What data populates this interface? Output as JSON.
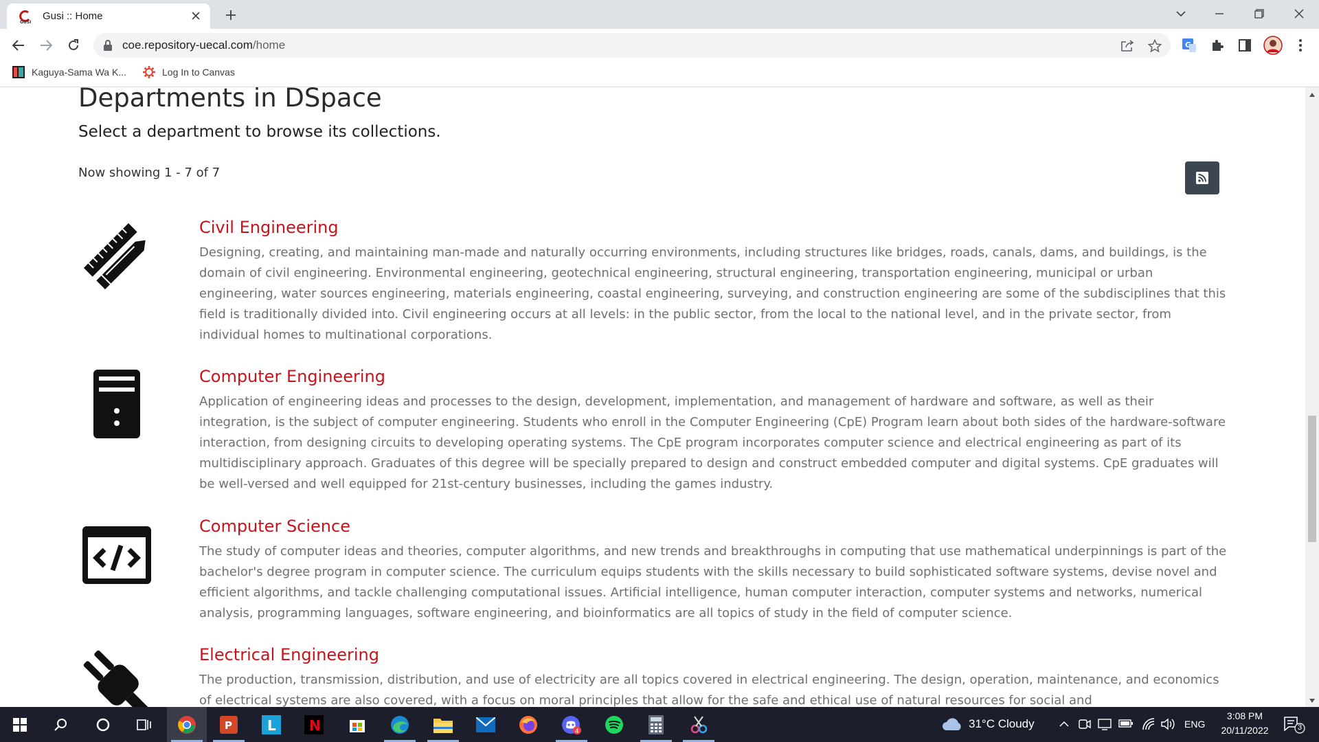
{
  "browser": {
    "tab_title": "Gusi :: Home",
    "url_domain": "coe.repository-uecal.com",
    "url_path": "/home",
    "bookmarks": [
      {
        "label": "Kaguya-Sama Wa K...",
        "icon": "manga-icon"
      },
      {
        "label": "Log In to Canvas",
        "icon": "canvas-icon"
      }
    ]
  },
  "page": {
    "heading": "Departments in DSpace",
    "subheading": "Select a department to browse its collections.",
    "showing": "Now showing 1 - 7 of 7",
    "departments": [
      {
        "title": "Civil Engineering",
        "icon": "ruler-pencil-icon",
        "description": "Designing, creating, and maintaining man-made and naturally occurring environments, including structures like bridges, roads, canals, dams, and buildings, is the domain of civil engineering. Environmental engineering, geotechnical engineering, structural engineering, transportation engineering, municipal or urban engineering, water sources engineering, materials engineering, coastal engineering, surveying, and construction engineering are some of the subdisciplines that this field is traditionally divided into. Civil engineering occurs at all levels: in the public sector, from the local to the national level, and in the private sector, from individual homes to multinational corporations."
      },
      {
        "title": "Computer Engineering",
        "icon": "computer-tower-icon",
        "description": "Application of engineering ideas and processes to the design, development, implementation, and management of hardware and software, as well as their integration, is the subject of computer engineering. Students who enroll in the Computer Engineering (CpE) Program learn about both sides of the hardware-software interaction, from designing circuits to developing operating systems. The CpE program incorporates computer science and electrical engineering as part of its multidisciplinary approach. Graduates of this degree will be specially prepared to design and construct embedded computer and digital systems. CpE graduates will be well-versed and well equipped for 21st-century businesses, including the games industry."
      },
      {
        "title": "Computer Science",
        "icon": "code-window-icon",
        "description": "The study of computer ideas and theories, computer algorithms, and new trends and breakthroughs in computing that use mathematical underpinnings is part of the bachelor's degree program in computer science. The curriculum equips students with the skills necessary to build sophisticated software systems, devise novel and efficient algorithms, and tackle challenging computational issues. Artificial intelligence, human computer interaction, computer systems and networks, numerical analysis, programming languages, software engineering, and bioinformatics are all topics of study in the field of computer science."
      },
      {
        "title": "Electrical Engineering",
        "icon": "plug-icon",
        "description": "The production, transmission, distribution, and use of electricity are all topics covered in electrical engineering. The design, operation, maintenance, and economics of electrical systems are also covered, with a focus on moral principles that allow for the safe and ethical use of natural resources for social and"
      }
    ]
  },
  "taskbar": {
    "weather": "31°C  Cloudy",
    "language": "ENG",
    "time": "3:08 PM",
    "date": "20/11/2022",
    "notifications": "3",
    "accent": "#8fb3e8"
  }
}
